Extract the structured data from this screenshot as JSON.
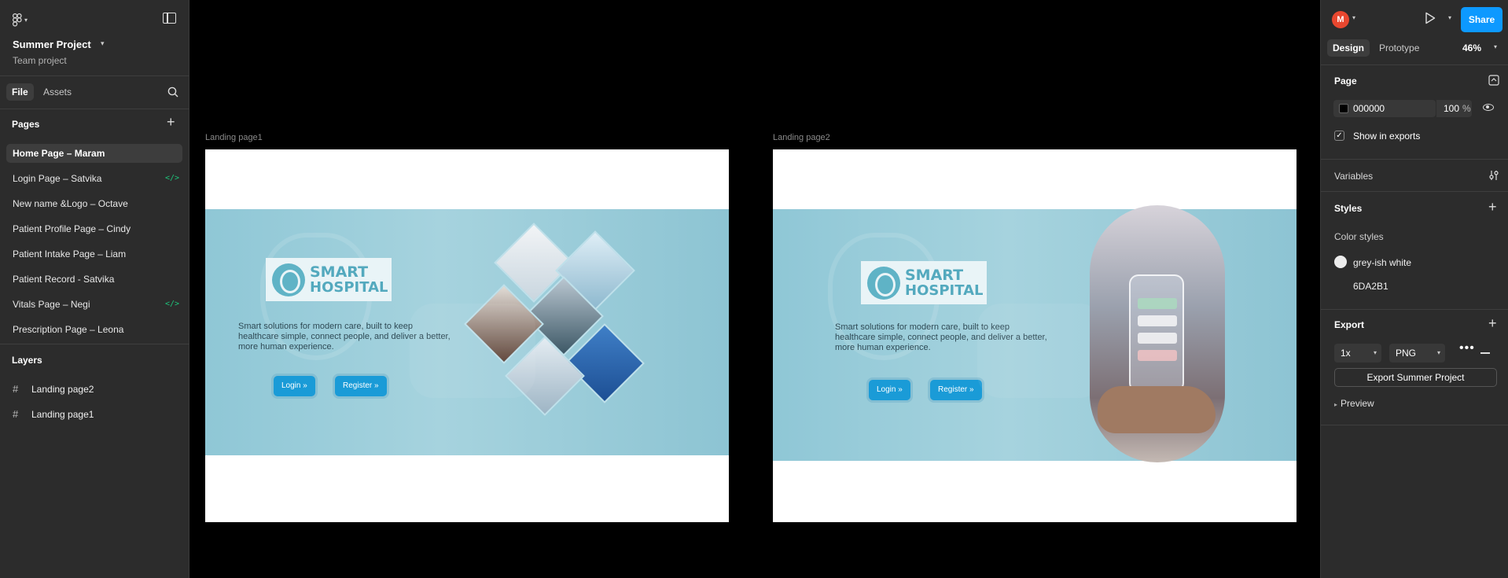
{
  "left_panel": {
    "project_title": "Summer Project",
    "project_subtitle": "Team project",
    "tabs": {
      "file": "File",
      "assets": "Assets"
    },
    "pages_heading": "Pages",
    "pages": [
      {
        "label": "Home Page – Maram",
        "active": true,
        "dev_mode": false
      },
      {
        "label": "Login Page – Satvika",
        "active": false,
        "dev_mode": true
      },
      {
        "label": "New name &Logo – Octave",
        "active": false,
        "dev_mode": false
      },
      {
        "label": "Patient Profile Page – Cindy",
        "active": false,
        "dev_mode": false
      },
      {
        "label": "Patient Intake Page – Liam",
        "active": false,
        "dev_mode": false
      },
      {
        "label": "Patient Record - Satvika",
        "active": false,
        "dev_mode": false
      },
      {
        "label": "Vitals Page – Negi",
        "active": false,
        "dev_mode": true
      },
      {
        "label": "Prescription Page – Leona",
        "active": false,
        "dev_mode": false
      }
    ],
    "dev_mode_glyph": "</>",
    "layers_heading": "Layers",
    "layers": [
      {
        "label": "Landing page2"
      },
      {
        "label": "Landing page1"
      }
    ]
  },
  "canvas": {
    "background": "#000000",
    "frames": [
      {
        "label": "Landing page1",
        "logo_line1": "SMART",
        "logo_line2": "HOSPITAL",
        "tagline": "Smart solutions for modern care, built to keep healthcare simple, connect people, and deliver a better, more human experience.",
        "login_button": "Login »",
        "register_button": "Register »"
      },
      {
        "label": "Landing page2",
        "logo_line1": "SMART",
        "logo_line2": "HOSPITAL",
        "tagline": "Smart solutions for modern care, built to keep healthcare simple, connect people, and deliver a better, more human experience.",
        "login_button": "Login »",
        "register_button": "Register »"
      }
    ]
  },
  "right_panel": {
    "avatar_initial": "M",
    "share_button": "Share",
    "tabs": {
      "design": "Design",
      "prototype": "Prototype"
    },
    "zoom": "46%",
    "page_section": {
      "heading": "Page",
      "color_hex": "000000",
      "opacity": "100",
      "opacity_unit": "%",
      "show_in_exports_label": "Show in exports",
      "show_in_exports_checked": true
    },
    "variables_heading": "Variables",
    "styles_heading": "Styles",
    "color_styles_heading": "Color styles",
    "color_styles": [
      {
        "name": "grey-ish white",
        "color": "#ececec"
      },
      {
        "name": "6DA2B1",
        "color": "#6DA2B1"
      }
    ],
    "export": {
      "heading": "Export",
      "scale": "1x",
      "format": "PNG",
      "button": "Export Summer Project",
      "preview_label": "Preview"
    }
  },
  "colors": {
    "accent": "#0d99ff",
    "banner": "#a6d3de",
    "cta": "#1a9bd7",
    "dev_mode": "#1ec37a",
    "avatar": "#e8472f"
  }
}
